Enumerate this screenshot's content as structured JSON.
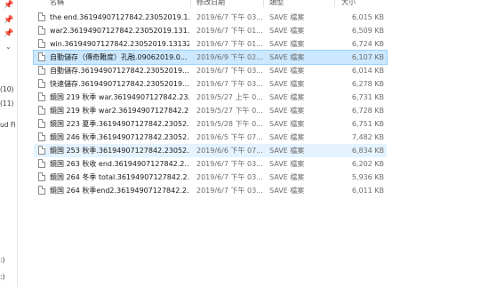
{
  "columns": {
    "name": "名稱",
    "date": "修改日期",
    "type": "類型",
    "size": "大小"
  },
  "nav": {
    "labels": [
      "(10)",
      "(11)",
      "ud Fi",
      ":)",
      ":)"
    ],
    "pins": [
      "pin-icon",
      "pin-icon",
      "pin-icon"
    ]
  },
  "files": [
    {
      "name": "the end.36194907127842.23052019.1...",
      "date": "2019/6/7 下午 03...",
      "type": "SAVE 檔案",
      "size": "6,015 KB",
      "state": ""
    },
    {
      "name": "war2.36194907127842.23052019.131...",
      "date": "2019/6/7 下午 01...",
      "type": "SAVE 檔案",
      "size": "6,509 KB",
      "state": ""
    },
    {
      "name": "win.36194907127842.23052019.13132...",
      "date": "2019/6/7 下午 01...",
      "type": "SAVE 檔案",
      "size": "6,724 KB",
      "state": ""
    },
    {
      "name": "自動儲存（傳奇難度）孔融.09062019.0...",
      "date": "2019/6/9 下午 02...",
      "type": "SAVE 檔案",
      "size": "6,107 KB",
      "state": "selected"
    },
    {
      "name": "自動儲存.36194907127842.23052019....",
      "date": "2019/6/7 下午 03...",
      "type": "SAVE 檔案",
      "size": "6,014 KB",
      "state": ""
    },
    {
      "name": "快速儲存.36194907127842.23052019....",
      "date": "2019/6/7 下午 03...",
      "type": "SAVE 檔案",
      "size": "6,278 KB",
      "state": ""
    },
    {
      "name": "鏡国 219 秋季 war.36194907127842.23...",
      "date": "2019/5/27 上午 0...",
      "type": "SAVE 檔案",
      "size": "6,731 KB",
      "state": ""
    },
    {
      "name": "鏡国 219 秋季 war2.36194907127842.2...",
      "date": "2019/5/27 下午 0...",
      "type": "SAVE 檔案",
      "size": "6,728 KB",
      "state": ""
    },
    {
      "name": "鏡国 223 夏季.36194907127842.23052...",
      "date": "2019/5/28 下午 0...",
      "type": "SAVE 檔案",
      "size": "6,751 KB",
      "state": ""
    },
    {
      "name": "鏡国 246 秋季.36194907127842.23052...",
      "date": "2019/6/5 下午 07...",
      "type": "SAVE 檔案",
      "size": "7,482 KB",
      "state": ""
    },
    {
      "name": "鏡国 253 秋季.36194907127842.23052...",
      "date": "2019/6/6 下午 07...",
      "type": "SAVE 檔案",
      "size": "6,834 KB",
      "state": "hover"
    },
    {
      "name": "鏡国 263 秋收 end.36194907127842.2...",
      "date": "2019/6/7 下午 03...",
      "type": "SAVE 檔案",
      "size": "6,202 KB",
      "state": ""
    },
    {
      "name": "鏡国 264 冬季 total.36194907127842.2...",
      "date": "2019/6/7 下午 03...",
      "type": "SAVE 檔案",
      "size": "5,936 KB",
      "state": ""
    },
    {
      "name": "鏡国 264 秋季end2.36194907127842.2...",
      "date": "2019/6/7 下午 03...",
      "type": "SAVE 檔案",
      "size": "6,011 KB",
      "state": ""
    }
  ]
}
